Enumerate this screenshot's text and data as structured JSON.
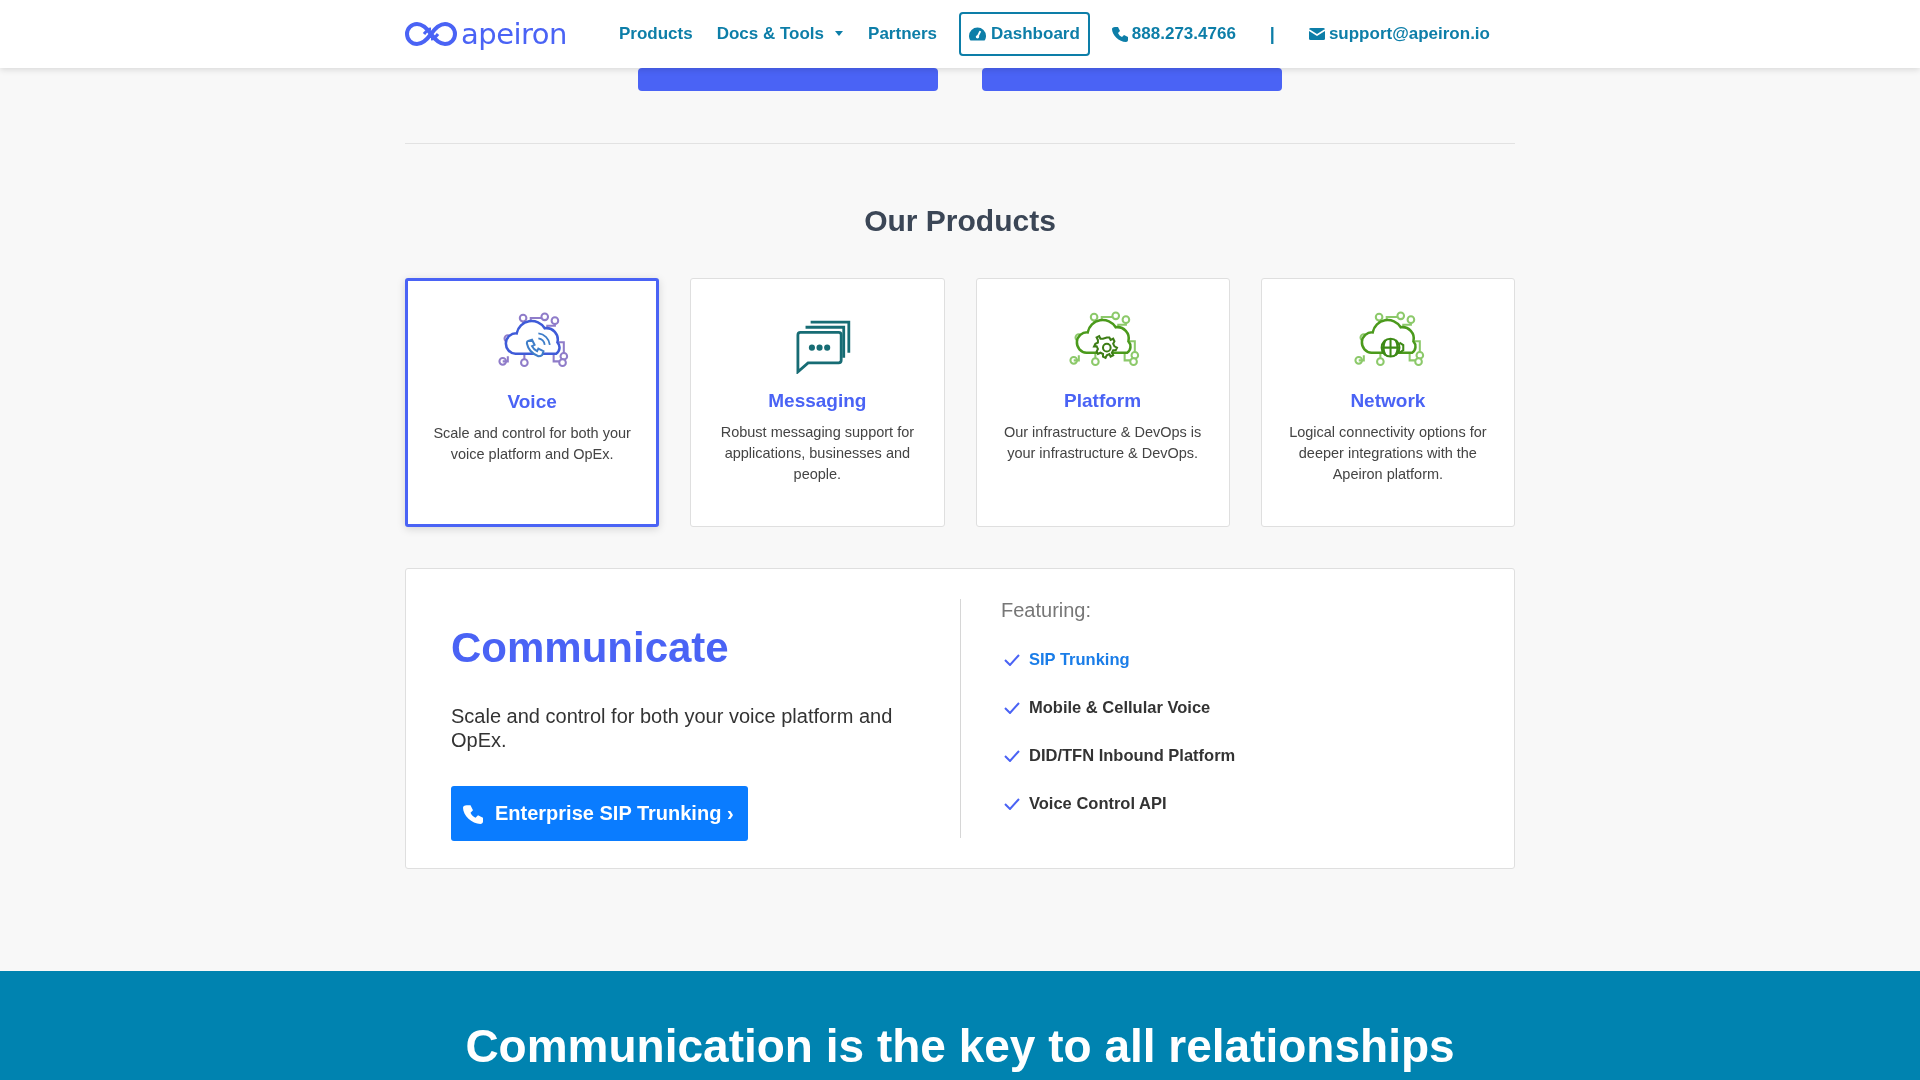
{
  "header": {
    "logo": "apeiron",
    "nav": [
      {
        "label": "Products",
        "kind": "link"
      },
      {
        "label": "Docs & Tools",
        "kind": "dropdown"
      },
      {
        "label": "Partners",
        "kind": "link"
      },
      {
        "label": "Dashboard",
        "kind": "button"
      },
      {
        "label": "888.273.4766",
        "kind": "phone"
      },
      {
        "label": "|",
        "kind": "separator"
      },
      {
        "label": "support@apeiron.io",
        "kind": "email"
      }
    ]
  },
  "hero_buttons": [
    {
      "kind": "button"
    },
    {
      "kind": "button"
    }
  ],
  "products": {
    "title": "Our Products",
    "cards": [
      {
        "name": "Voice",
        "description": "Scale and control for both your voice platform and OpEx.",
        "selected": true
      },
      {
        "name": "Messaging",
        "description": "Robust messaging support for applications, businesses and people.",
        "selected": false
      },
      {
        "name": "Platform",
        "description": "Our infrastructure & DevOps is your infrastructure & DevOps.",
        "selected": false
      },
      {
        "name": "Network",
        "description": "Logical connectivity options for deeper integrations with the Apeiron platform.",
        "selected": false
      }
    ]
  },
  "detail": {
    "title": "Communicate",
    "description": "Scale and control for both your voice platform and OpEx.",
    "button": "Enterprise SIP Trunking ›",
    "featuring_label": "Featuring:",
    "features": [
      {
        "label": "SIP Trunking",
        "selected": true
      },
      {
        "label": "Mobile & Cellular Voice",
        "selected": false
      },
      {
        "label": "DID/TFN Inbound Platform",
        "selected": false
      },
      {
        "label": "Voice Control API",
        "selected": false
      }
    ]
  },
  "footer_banner": {
    "heading": "Communication is the key to all relationships"
  }
}
